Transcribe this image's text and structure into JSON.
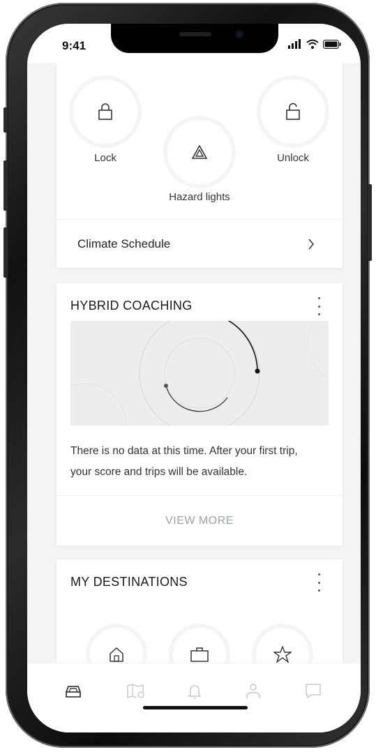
{
  "status_bar": {
    "time": "9:41"
  },
  "controls": {
    "lock_label": "Lock",
    "unlock_label": "Unlock",
    "hazard_label": "Hazard lights",
    "climate_label": "Climate Schedule"
  },
  "hybrid_coaching": {
    "title": "HYBRID COACHING",
    "message_line1": "There is no data at this time. After your first trip,",
    "message_line2": "your score and trips will be available.",
    "view_more_label": "VIEW MORE"
  },
  "destinations": {
    "title": "MY DESTINATIONS",
    "items": [
      "home-icon",
      "briefcase-icon",
      "star-icon"
    ]
  },
  "tabbar": {
    "items": [
      "car-icon",
      "map-icon",
      "bell-icon",
      "profile-icon",
      "chat-icon"
    ]
  },
  "colors": {
    "screen_bg": "#f4f4f4",
    "card_bg": "#ffffff",
    "view_more": "#9aa3a6",
    "tab_active": "#222222",
    "tab_inactive": "#c8c8c8"
  }
}
